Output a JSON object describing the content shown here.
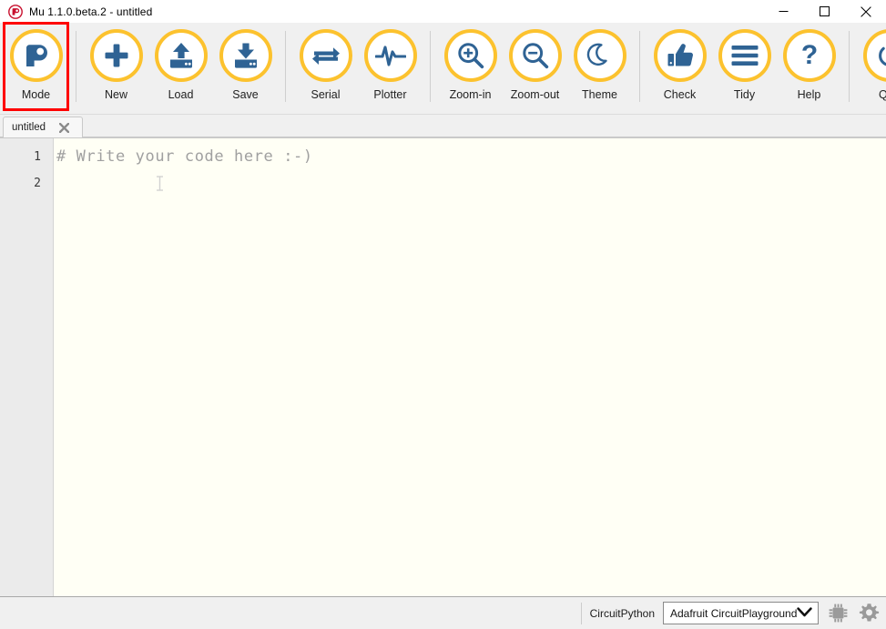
{
  "window": {
    "title": "Mu 1.1.0.beta.2 - untitled",
    "logo_icon": "mu-logo-icon",
    "controls": {
      "minimize": "minimize-icon",
      "maximize": "maximize-icon",
      "close": "close-icon"
    }
  },
  "toolbar": {
    "groups": [
      {
        "buttons": [
          {
            "label": "Mode",
            "icon": "mode-icon",
            "highlighted": true
          }
        ]
      },
      {
        "buttons": [
          {
            "label": "New",
            "icon": "plus-icon",
            "highlighted": false
          },
          {
            "label": "Load",
            "icon": "upload-icon",
            "highlighted": false
          },
          {
            "label": "Save",
            "icon": "download-icon",
            "highlighted": false
          }
        ]
      },
      {
        "buttons": [
          {
            "label": "Serial",
            "icon": "serial-arrows-icon",
            "highlighted": false
          },
          {
            "label": "Plotter",
            "icon": "waveform-icon",
            "highlighted": false
          }
        ]
      },
      {
        "buttons": [
          {
            "label": "Zoom-in",
            "icon": "magnifier-plus-icon",
            "highlighted": false
          },
          {
            "label": "Zoom-out",
            "icon": "magnifier-minus-icon",
            "highlighted": false
          },
          {
            "label": "Theme",
            "icon": "moon-icon",
            "highlighted": false
          }
        ]
      },
      {
        "buttons": [
          {
            "label": "Check",
            "icon": "thumbs-up-icon",
            "highlighted": false
          },
          {
            "label": "Tidy",
            "icon": "hamburger-icon",
            "highlighted": false
          },
          {
            "label": "Help",
            "icon": "question-mark-icon",
            "highlighted": false
          }
        ]
      },
      {
        "buttons": [
          {
            "label": "Quit",
            "icon": "power-icon",
            "highlighted": false
          }
        ]
      }
    ],
    "highlight_color": "#fe0000",
    "ring_color": "#fcc22e",
    "icon_color": "#2f6394"
  },
  "tabs": [
    {
      "label": "untitled",
      "close_icon": "close-tab-icon",
      "active": true
    }
  ],
  "editor": {
    "line_numbers": [
      "1",
      "2"
    ],
    "lines": [
      "# Write your code here :-)",
      ""
    ],
    "caret_icon": "text-caret-icon",
    "background": "#fffff5",
    "text_color": "#a0a0a0"
  },
  "statusbar": {
    "mode_label": "CircuitPython",
    "device_select": {
      "value": "Adafruit CircuitPlayground",
      "chevron_icon": "chevron-down-icon"
    },
    "icons": [
      {
        "name": "microchip-icon"
      },
      {
        "name": "gear-icon"
      }
    ]
  }
}
